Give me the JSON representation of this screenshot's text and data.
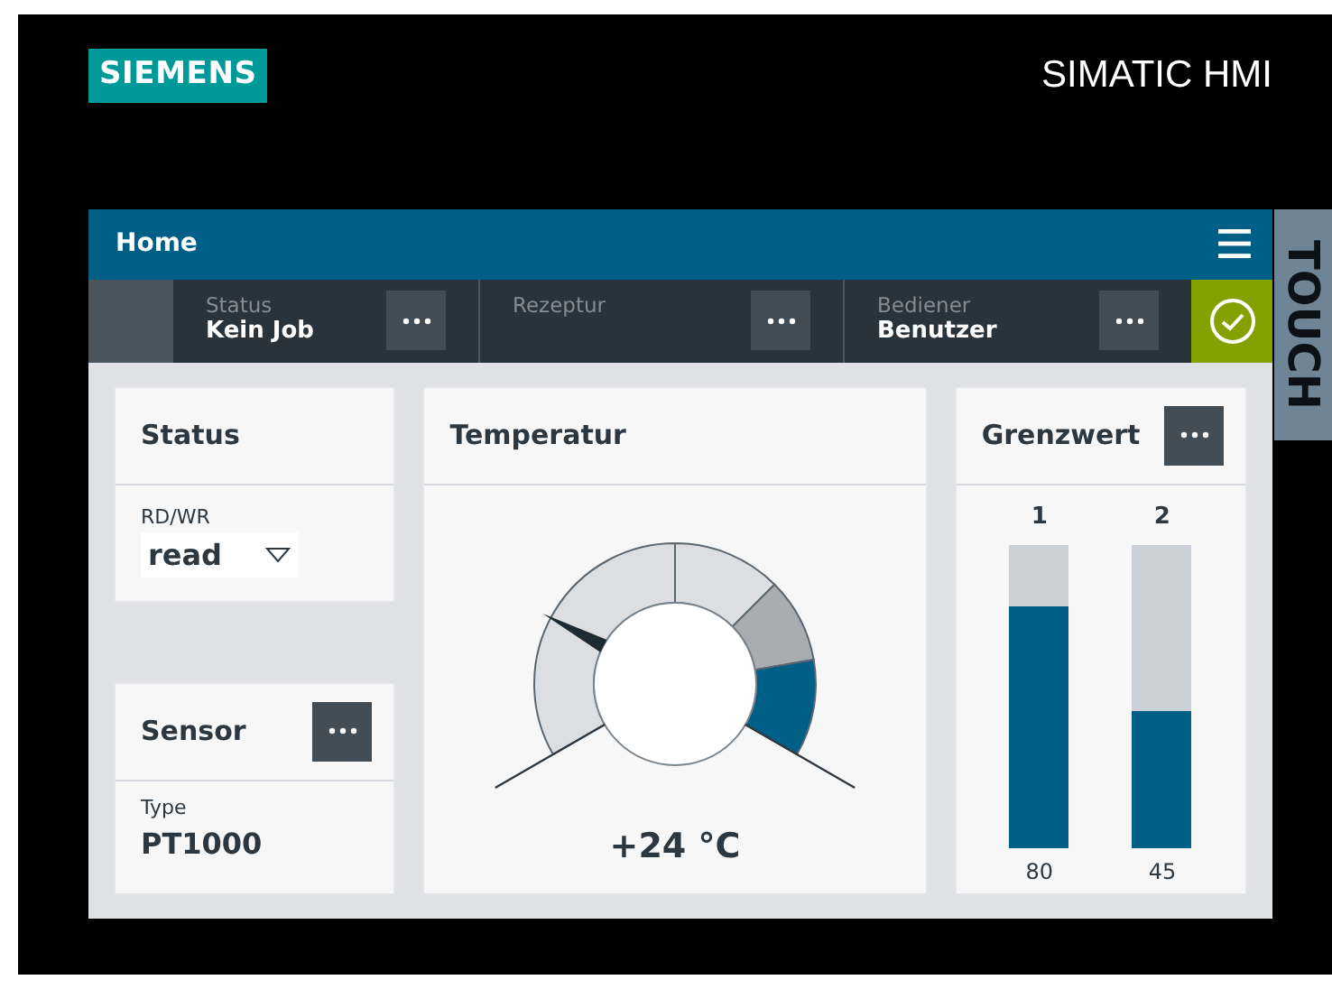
{
  "header": {
    "logo": "SIEMENS",
    "product": "SIMATIC HMI"
  },
  "title_bar": {
    "title": "Home"
  },
  "status_bar": {
    "fields": [
      {
        "label": "Status",
        "value": "Kein Job"
      },
      {
        "label": "Rezeptur"
      },
      {
        "label": "Bediener",
        "value": "Benutzer"
      }
    ],
    "ok": true
  },
  "sticker": {
    "text": "TOUCH"
  },
  "status_card": {
    "title": "Status",
    "field_label": "RD/WR",
    "value": "read"
  },
  "sensor_card": {
    "title": "Sensor",
    "field_label": "Type",
    "value": "PT1000"
  },
  "temperature_card": {
    "title": "Temperatur",
    "reading": "+24 °C"
  },
  "limit_card": {
    "title": "Grenzwert",
    "bars": [
      {
        "label": "1",
        "level": 0.8,
        "reading": "80"
      },
      {
        "label": "2",
        "level": 0.45,
        "reading": "45"
      }
    ]
  }
}
